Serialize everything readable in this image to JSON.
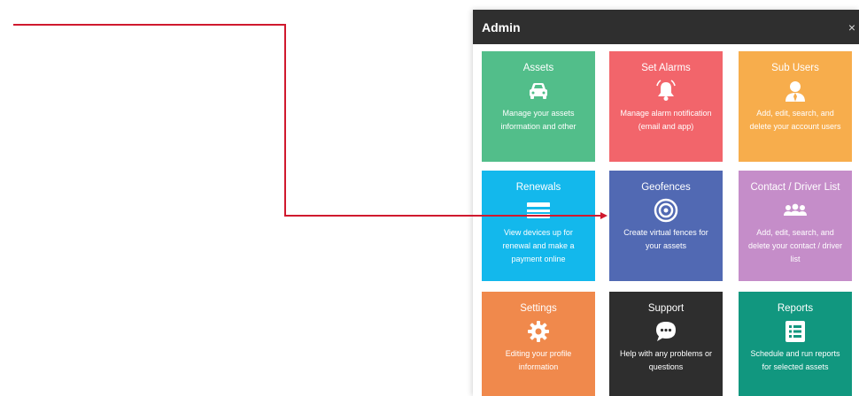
{
  "panel": {
    "title": "Admin",
    "close_glyph": "×"
  },
  "tiles": [
    {
      "title": "Assets",
      "icon": "car-icon",
      "desc": "Manage your assets information and other",
      "color": "#52be8a"
    },
    {
      "title": "Set Alarms",
      "icon": "bell-icon",
      "desc": "Manage alarm notification (email and app)",
      "color": "#f2656b"
    },
    {
      "title": "Sub Users",
      "icon": "user-icon",
      "desc": "Add, edit, search, and delete your account users",
      "color": "#f7ad4c"
    },
    {
      "title": "Renewals",
      "icon": "credit-card-icon",
      "desc": "View devices up for renewal and make a payment online",
      "color": "#13b8ec"
    },
    {
      "title": "Geofences",
      "icon": "geofence-target-icon",
      "desc": "Create virtual fences for your assets",
      "color": "#5169b3"
    },
    {
      "title": "Contact / Driver List",
      "icon": "contacts-group-icon",
      "desc": "Add, edit, search, and delete your contact / driver list",
      "color": "#c58dc9"
    },
    {
      "title": "Settings",
      "icon": "gear-icon",
      "desc": "Editing your profile information",
      "color": "#f0894c"
    },
    {
      "title": "Support",
      "icon": "chat-bubble-icon",
      "desc": "Help with any problems or questions",
      "color": "#2e2e2e"
    },
    {
      "title": "Reports",
      "icon": "report-list-icon",
      "desc": "Schedule and run reports for selected assets",
      "color": "#11977f"
    }
  ],
  "annotation": {
    "arrow_color": "#d0192e"
  }
}
